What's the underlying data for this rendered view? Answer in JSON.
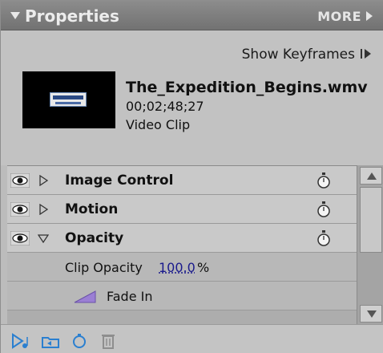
{
  "header": {
    "title": "Properties",
    "more_label": "MORE",
    "title_icon": "collapse-triangle-icon",
    "more_icon": "right-arrow-icon"
  },
  "clip": {
    "show_keyframes_label": "Show Keyframes",
    "show_keyframes_icon": "show-keyframes-icon",
    "name": "The_Expedition_Begins.wmv",
    "timecode": "00;02;48;27",
    "type": "Video Clip",
    "thumbnail": "clip-thumbnail"
  },
  "effects": [
    {
      "label": "Image Control",
      "expanded": false,
      "visible": true
    },
    {
      "label": "Motion",
      "expanded": false,
      "visible": true
    },
    {
      "label": "Opacity",
      "expanded": true,
      "visible": true
    }
  ],
  "opacity_params": {
    "clip_opacity_label": "Clip Opacity",
    "clip_opacity_value": "100.0",
    "clip_opacity_unit": "%",
    "fade_in_label": "Fade In"
  },
  "toolbar": {
    "icons": [
      "play-audio-icon",
      "folder-effect-icon",
      "reset-icon",
      "trash-icon"
    ]
  },
  "colors": {
    "titlebar": "#7f7f7f",
    "panel": "#c2c2c2",
    "fade_icon": "#9b7fd4",
    "link_value": "#1a1a8c",
    "play_icon": "#2a7fd0"
  }
}
